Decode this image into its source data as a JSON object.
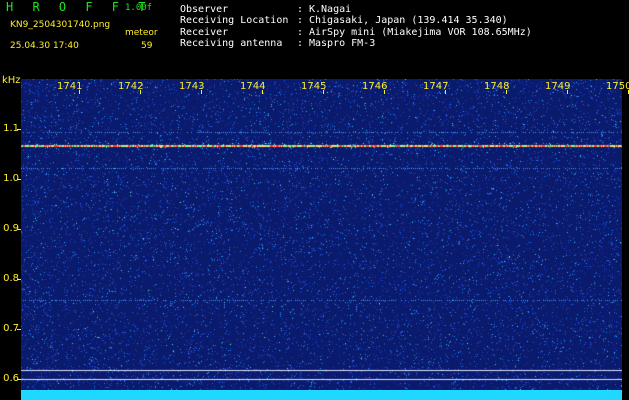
{
  "header": {
    "brand": "H R O F F T",
    "version": "1.00f",
    "filename": "KN9_2504301740.png",
    "meteor_label": "meteor",
    "datetime": "25.04.30 17:40",
    "count": "59"
  },
  "info": [
    {
      "label": "Observer",
      "value": "K.Nagai"
    },
    {
      "label": "Receiving Location",
      "value": "Chigasaki, Japan (139.414 35.340)"
    },
    {
      "label": "Receiver",
      "value": "AirSpy mini (Miakejima VOR 108.65MHz)"
    },
    {
      "label": "Receiving antenna",
      "value": "Maspro FM-3"
    }
  ],
  "info_colon": ":",
  "axis": {
    "y_unit": "kHz",
    "y_ticks": [
      "1.1",
      "1.0",
      "0.9",
      "0.8",
      "0.7",
      "0.6"
    ],
    "x_ticks": [
      "1741",
      "1742",
      "1743",
      "1744",
      "1745",
      "1746",
      "1747",
      "1748",
      "1749",
      "1750"
    ]
  },
  "colors": {
    "background": "#000000",
    "title_green": "#1fe51f",
    "label_yellow": "#ffef2b",
    "spectrogram_base": "#0a1a6c",
    "carrier_line": "#ff3b3b",
    "floor_cyan": "#1fd8ff"
  }
}
